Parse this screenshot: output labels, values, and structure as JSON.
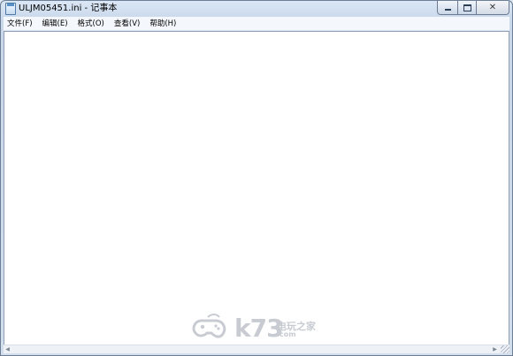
{
  "window": {
    "title": "ULJM05451.ini - 记事本"
  },
  "caption": {
    "minimize": "minimize",
    "maximize": "maximize",
    "close": "close"
  },
  "menu": {
    "items": [
      {
        "label": "文件(F)"
      },
      {
        "label": "编辑(E)"
      },
      {
        "label": "格式(O)"
      },
      {
        "label": "查看(V)"
      },
      {
        "label": "帮助(H)"
      }
    ]
  },
  "editor": {
    "content": ""
  },
  "watermark": {
    "brand": "k73",
    "tagline": "电玩之家",
    "domain": ".com"
  },
  "colors": {
    "frame": "#c9d7e9",
    "editor_bg": "#ffffff",
    "watermark": "#c8ccd2"
  }
}
